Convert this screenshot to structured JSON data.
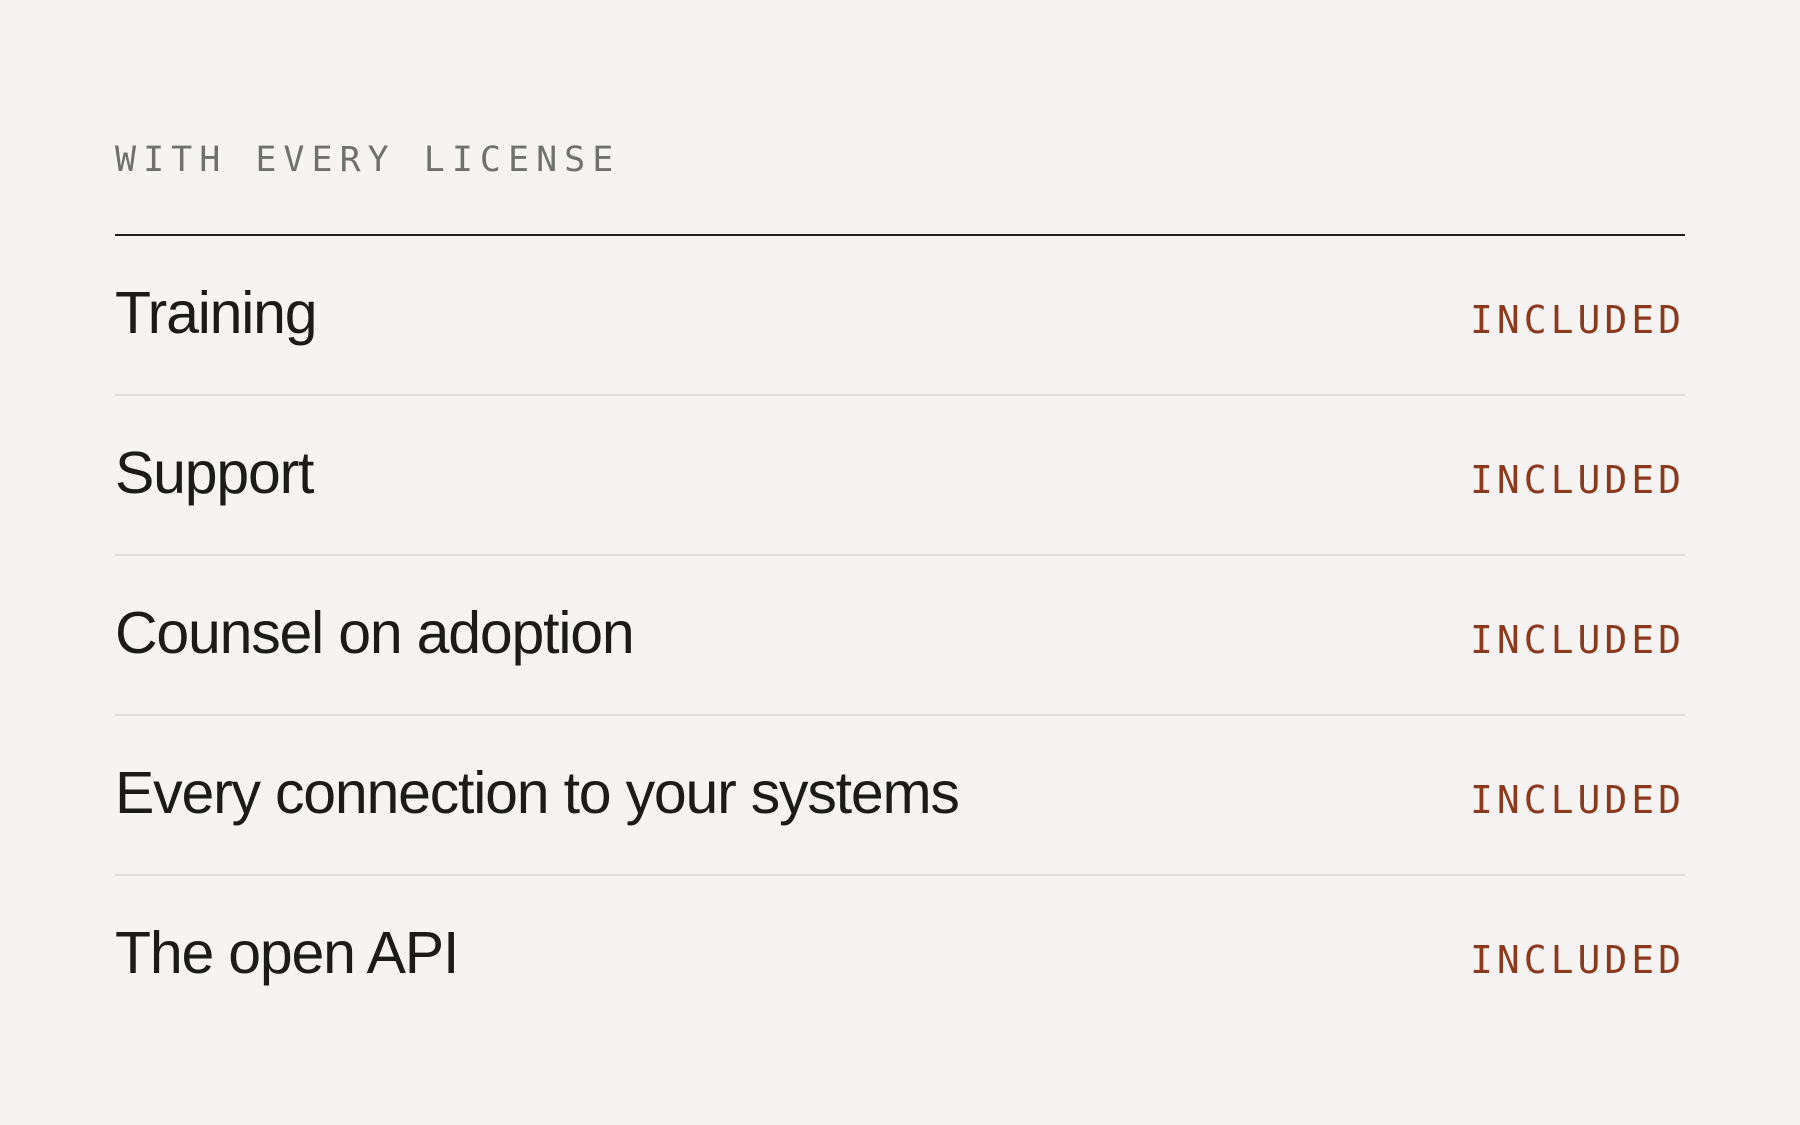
{
  "section": {
    "eyebrow": "WITH EVERY LICENSE"
  },
  "features": [
    {
      "name": "Training",
      "status": "INCLUDED"
    },
    {
      "name": "Support",
      "status": "INCLUDED"
    },
    {
      "name": "Counsel on adoption",
      "status": "INCLUDED"
    },
    {
      "name": "Every connection to your systems",
      "status": "INCLUDED"
    },
    {
      "name": "The open API",
      "status": "INCLUDED"
    }
  ],
  "colors": {
    "background": "#f5f4f2",
    "text": "#1b1c1a",
    "eyebrow": "#6f716c",
    "accent": "#8c3a1e",
    "divider": "#e2e0dc"
  }
}
